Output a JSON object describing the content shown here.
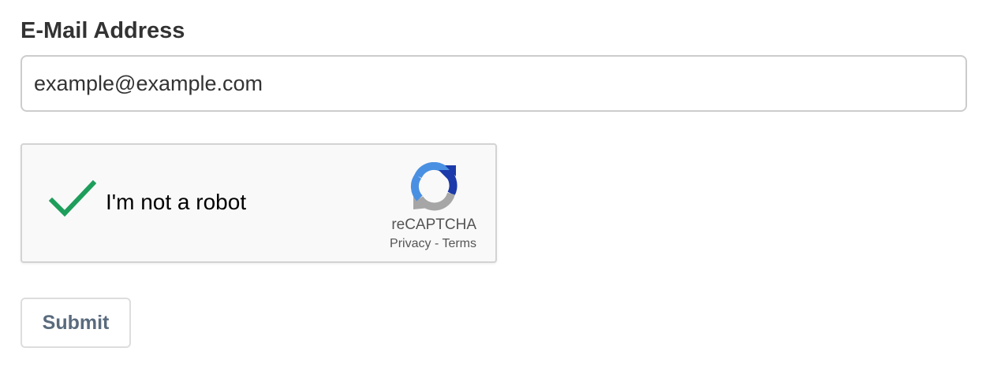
{
  "email_field": {
    "label": "E-Mail Address",
    "value": "example@example.com"
  },
  "recaptcha": {
    "checkbox_label": "I'm not a robot",
    "checked": true,
    "brand": "reCAPTCHA",
    "privacy_link": "Privacy",
    "separator": " - ",
    "terms_link": "Terms",
    "check_color": "#1e9e5b",
    "logo_icon": "recaptcha-logo-icon"
  },
  "submit": {
    "label": "Submit"
  }
}
